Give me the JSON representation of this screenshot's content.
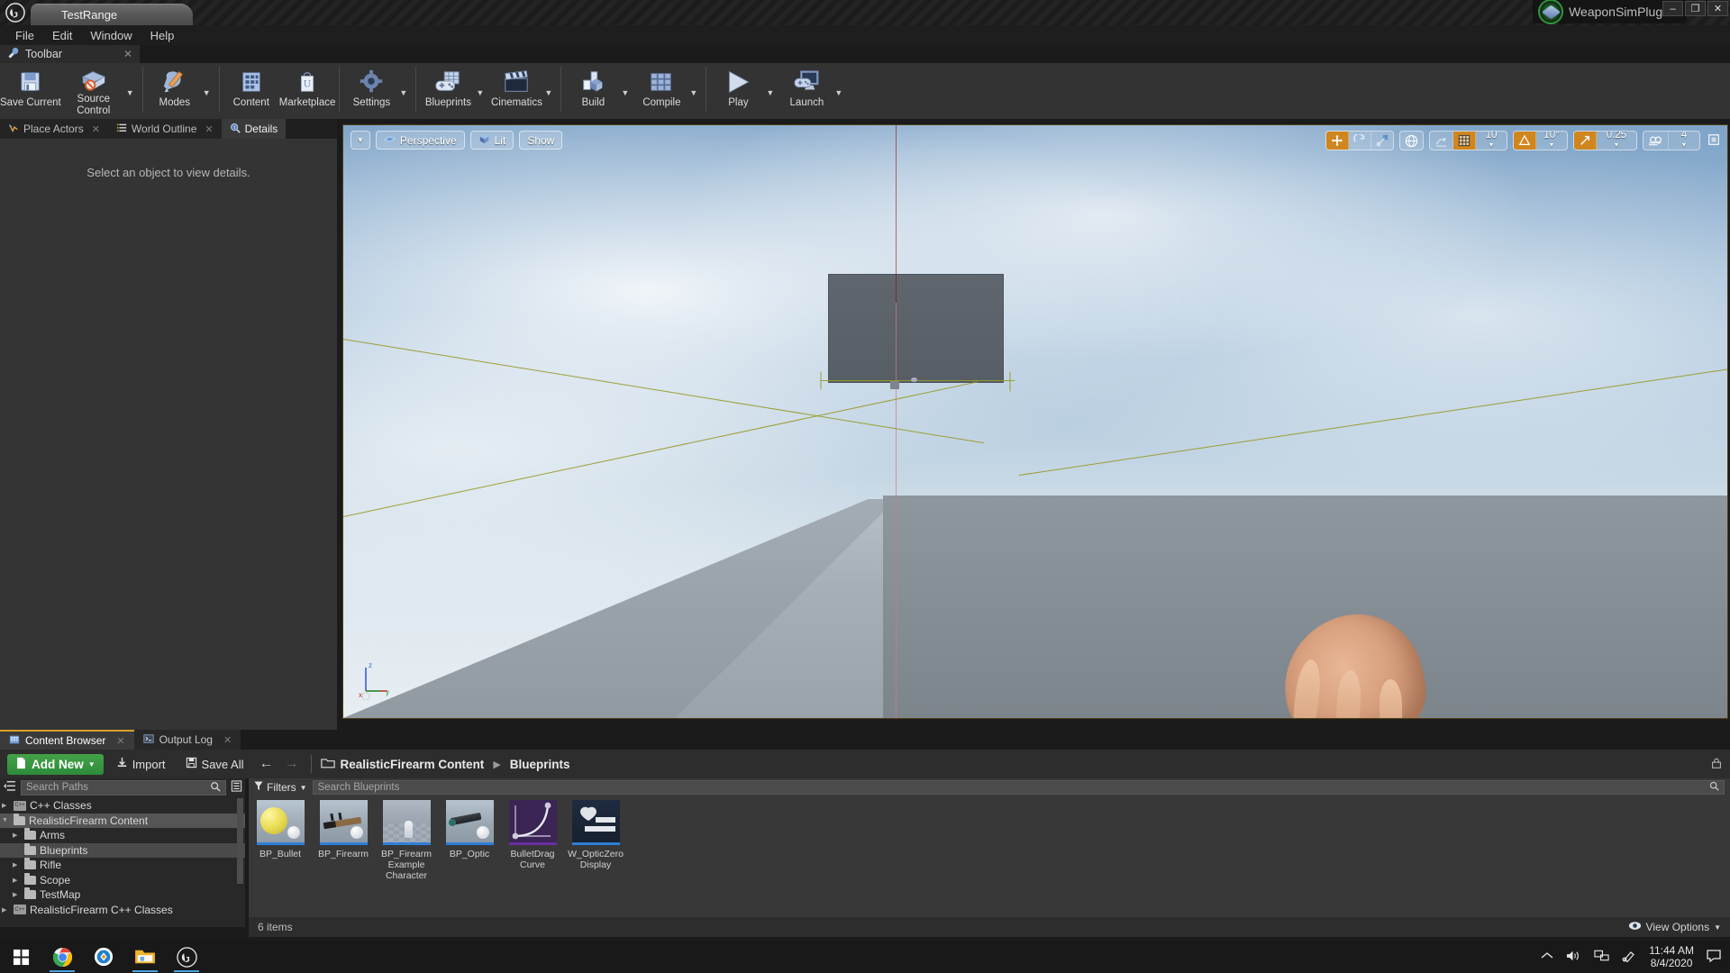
{
  "window": {
    "project_tab": "TestRange",
    "plugin_label": "WeaponSimPlugin",
    "minimize": "–",
    "restore": "❐",
    "close": "✕"
  },
  "menubar": {
    "items": [
      "File",
      "Edit",
      "Window",
      "Help"
    ]
  },
  "toolbar_tab": {
    "label": "Toolbar",
    "close": "✕"
  },
  "toolbar": {
    "items": [
      {
        "label": "Save Current",
        "icon": "save-disk-icon",
        "caret": false
      },
      {
        "label": "Source Control",
        "icon": "source-control-icon",
        "caret": true
      },
      {
        "label": "Modes",
        "icon": "modes-wrench-icon",
        "caret": true
      },
      {
        "label": "Content",
        "icon": "content-grid-icon",
        "caret": false
      },
      {
        "label": "Marketplace",
        "icon": "marketplace-bag-icon",
        "caret": false
      },
      {
        "label": "Settings",
        "icon": "settings-gear-icon",
        "caret": true
      },
      {
        "label": "Blueprints",
        "icon": "blueprints-gamepad-icon",
        "caret": true
      },
      {
        "label": "Cinematics",
        "icon": "cinematics-clapper-icon",
        "caret": true
      },
      {
        "label": "Build",
        "icon": "build-blocks-icon",
        "caret": true
      },
      {
        "label": "Compile",
        "icon": "compile-cubes-icon",
        "caret": true
      },
      {
        "label": "Play",
        "icon": "play-triangle-icon",
        "caret": true
      },
      {
        "label": "Launch",
        "icon": "launch-monitor-icon",
        "caret": true
      }
    ]
  },
  "left_panel": {
    "tabs": [
      {
        "label": "Place Actors",
        "icon": "place-actors-icon",
        "active": false
      },
      {
        "label": "World Outline",
        "icon": "world-outliner-icon",
        "active": false
      },
      {
        "label": "Details",
        "icon": "details-magnifier-icon",
        "active": true
      }
    ],
    "empty_hint": "Select an object to view details."
  },
  "viewport": {
    "left_controls": [
      {
        "name": "viewport-options-dropdown",
        "label": ""
      },
      {
        "name": "view-perspective-button",
        "label": "Perspective"
      },
      {
        "name": "view-lighting-lit-button",
        "label": "Lit"
      },
      {
        "name": "view-show-menu-button",
        "label": "Show"
      }
    ],
    "right_controls": {
      "transform_modes": [
        "translate",
        "rotate",
        "scale"
      ],
      "coordinate_system": "world",
      "surface_snap": "surface-snap-icon",
      "grid_snap_enabled": true,
      "grid_snap_value": "10",
      "angle_snap_enabled": true,
      "angle_snap_value": "10°",
      "scale_snap_enabled": true,
      "scale_snap_value": "0.25",
      "camera_speed_icon": "camera-speed-icon",
      "camera_speed_value": "4",
      "maximize_icon": "maximize-viewport-icon"
    },
    "axis_labels": {
      "z": "z",
      "x": "x",
      "y": "y"
    }
  },
  "content_browser": {
    "tabs": [
      {
        "label": "Content Browser",
        "icon": "content-browser-icon",
        "active": true
      },
      {
        "label": "Output Log",
        "icon": "output-log-icon",
        "active": false
      }
    ],
    "toolbar": {
      "add_new": "Add New",
      "import": "Import",
      "save_all": "Save All",
      "back_arrow": "←",
      "forward_arrow": "→",
      "breadcrumb": [
        "RealisticFirearm Content",
        "Blueprints"
      ]
    },
    "paths": {
      "search_placeholder": "Search Paths",
      "tree": [
        {
          "label": "C++ Classes",
          "depth": 0,
          "icon": "cpp-classes-icon",
          "expandable": true,
          "selected": false
        },
        {
          "label": "RealisticFirearm Content",
          "depth": 0,
          "icon": "folder-icon",
          "expandable": true,
          "expanded": true,
          "selected": true
        },
        {
          "label": "Arms",
          "depth": 1,
          "icon": "folder-icon",
          "expandable": true,
          "selected": false
        },
        {
          "label": "Blueprints",
          "depth": 1,
          "icon": "folder-icon",
          "expandable": false,
          "selected": true
        },
        {
          "label": "Rifle",
          "depth": 1,
          "icon": "folder-icon",
          "expandable": true,
          "selected": false
        },
        {
          "label": "Scope",
          "depth": 1,
          "icon": "folder-icon",
          "expandable": true,
          "selected": false
        },
        {
          "label": "TestMap",
          "depth": 1,
          "icon": "folder-icon",
          "expandable": true,
          "selected": false
        },
        {
          "label": "RealisticFirearm C++ Classes",
          "depth": 0,
          "icon": "cpp-classes-icon",
          "expandable": true,
          "selected": false
        }
      ]
    },
    "assets": {
      "filters_label": "Filters",
      "search_placeholder": "Search Blueprints",
      "items": [
        {
          "name": "BP_Bullet",
          "thumb": "yellow-sphere",
          "strip": "#2f7fd8"
        },
        {
          "name": "BP_Firearm",
          "thumb": "rifle",
          "strip": "#2f7fd8"
        },
        {
          "name": "BP_Firearm Example Character",
          "thumb": "character",
          "strip": "#2f7fd8"
        },
        {
          "name": "BP_Optic",
          "thumb": "optic",
          "strip": "#2f7fd8"
        },
        {
          "name": "BulletDrag Curve",
          "thumb": "curve",
          "strip": "#6a2fa0"
        },
        {
          "name": "W_OpticZero Display",
          "thumb": "widget",
          "strip": "#2f7fd8"
        }
      ]
    },
    "status": {
      "item_count": "6 items",
      "view_options": "View Options"
    }
  },
  "taskbar": {
    "icons": [
      "windows-start-icon",
      "chrome-icon",
      "app-blue-icon",
      "file-explorer-icon",
      "unreal-engine-icon"
    ],
    "tray": [
      "chevron-up-icon",
      "volume-icon",
      "network-icon",
      "pen-icon"
    ],
    "clock_time": "11:44 AM",
    "clock_date": "8/4/2020",
    "notification_icon": "notification-icon"
  },
  "colors": {
    "accent_orange": "#d0861f",
    "green_add": "#2e8b3a",
    "panel_dark": "#282828",
    "toolbar_gray": "#333333"
  }
}
